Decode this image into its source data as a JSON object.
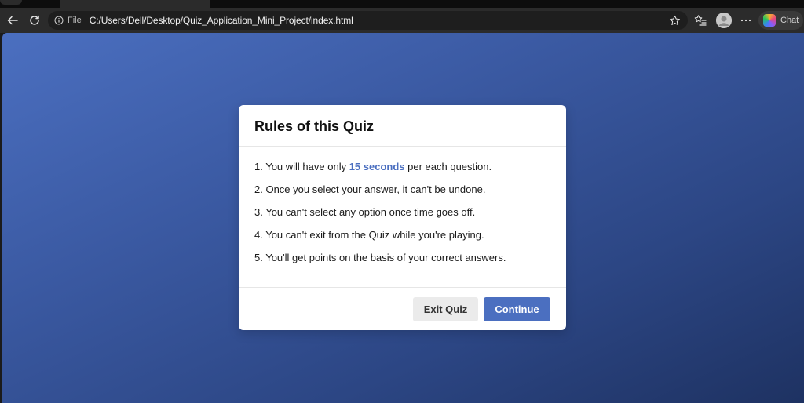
{
  "browser": {
    "scheme": "File",
    "url": "C:/Users/Dell/Desktop/Quiz_Application_Mini_Project/index.html",
    "copilot_label": "Chat"
  },
  "quiz": {
    "title": "Rules of this Quiz",
    "rules": [
      {
        "prefix": "1. You will have only ",
        "highlight": "15 seconds",
        "suffix": " per each question."
      },
      {
        "text": "2. Once you select your answer, it can't be undone."
      },
      {
        "text": "3. You can't select any option once time goes off."
      },
      {
        "text": "4. You can't exit from the Quiz while you're playing."
      },
      {
        "text": "5. You'll get points on the basis of your correct answers."
      }
    ],
    "exit_label": "Exit Quiz",
    "continue_label": "Continue"
  },
  "colors": {
    "accent": "#4b6fc0",
    "background_start": "#4b6fc0",
    "background_end": "#1e3262"
  }
}
